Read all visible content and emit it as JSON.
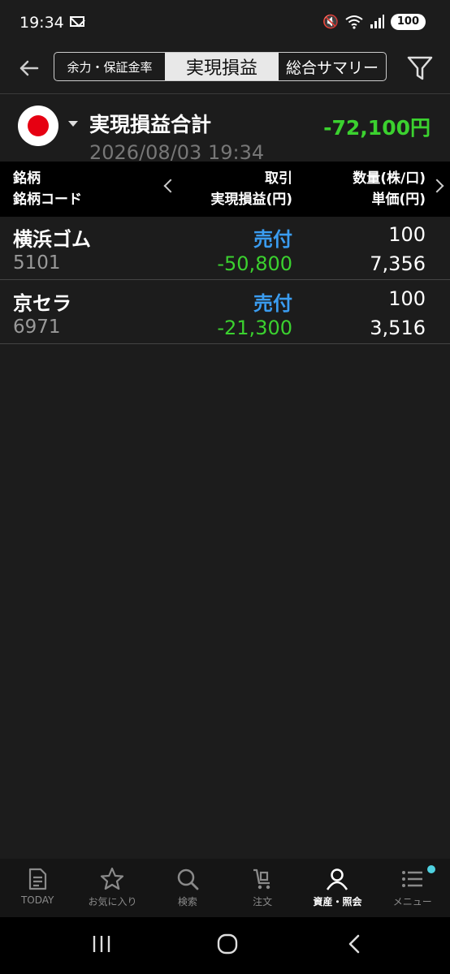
{
  "status_bar": {
    "time": "19:34",
    "battery": "100"
  },
  "header": {
    "tabs": [
      {
        "label": "余力・保証金率"
      },
      {
        "label": "実現損益"
      },
      {
        "label": "総合サマリー"
      }
    ],
    "active_tab": "実現損益"
  },
  "summary": {
    "title": "実現損益合計",
    "value": "-72,100円",
    "datetime": "2026/08/03 19:34",
    "market_flag": "japan-flag-icon"
  },
  "columns": {
    "c1_line1": "銘柄",
    "c1_line2": "銘柄コード",
    "c2_line1": "取引",
    "c2_line2": "実現損益(円)",
    "c3_line1": "数量(株/口)",
    "c3_line2": "単価(円)"
  },
  "rows": [
    {
      "name": "横浜ゴム",
      "code": "5101",
      "side": "売付",
      "pl": "-50,800",
      "qty": "100",
      "price": "7,356"
    },
    {
      "name": "京セラ",
      "code": "6971",
      "side": "売付",
      "pl": "-21,300",
      "qty": "100",
      "price": "3,516"
    }
  ],
  "bottom_nav": [
    {
      "label": "TODAY",
      "icon": "document-icon"
    },
    {
      "label": "お気に入り",
      "icon": "star-icon"
    },
    {
      "label": "検索",
      "icon": "search-icon"
    },
    {
      "label": "注文",
      "icon": "cart-icon"
    },
    {
      "label": "資産・照会",
      "icon": "person-icon"
    },
    {
      "label": "メニュー",
      "icon": "menu-icon"
    }
  ],
  "colors": {
    "positive_green": "#3bd12f",
    "sell_blue": "#3a9cf0",
    "flag_red": "#e60012"
  }
}
